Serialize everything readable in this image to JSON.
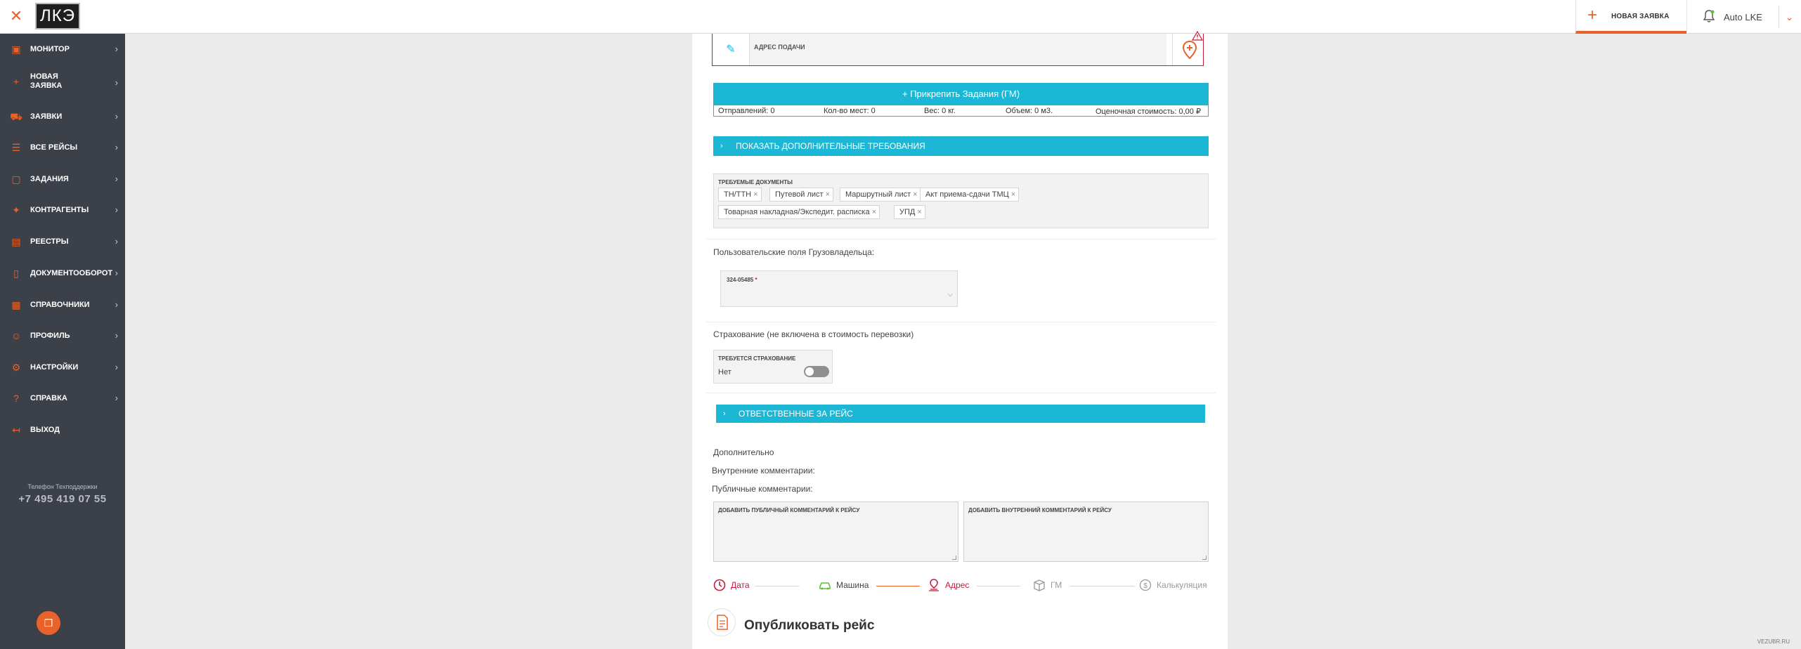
{
  "topbar": {
    "logo_text": "ЛКЭ",
    "new_order_label": "НОВАЯ ЗАЯВКА",
    "user_name": "Auto LKE"
  },
  "sidebar": {
    "items": [
      {
        "label": "МОНИТОР",
        "icon": "monitor-icon"
      },
      {
        "label": "НОВАЯ ЗАЯВКА",
        "icon": "plus-icon"
      },
      {
        "label": "ЗАЯВКИ",
        "icon": "truck-icon"
      },
      {
        "label": "ВСЕ РЕЙСЫ",
        "icon": "list-icon"
      },
      {
        "label": "ЗАДАНИЯ",
        "icon": "box-icon"
      },
      {
        "label": "КОНТРАГЕНТЫ",
        "icon": "handshake-icon"
      },
      {
        "label": "РЕЕСТРЫ",
        "icon": "registry-icon"
      },
      {
        "label": "ДОКУМЕНТООБОРОТ",
        "icon": "document-icon"
      },
      {
        "label": "СПРАВОЧНИКИ",
        "icon": "book-icon"
      },
      {
        "label": "ПРОФИЛЬ",
        "icon": "profile-icon"
      },
      {
        "label": "НАСТРОЙКИ",
        "icon": "gear-icon"
      },
      {
        "label": "СПРАВКА",
        "icon": "help-icon"
      },
      {
        "label": "ВЫХОД",
        "icon": "logout-icon"
      }
    ],
    "support_label": "Телефон Техподдержки",
    "support_phone": "+7 495 419 07 55"
  },
  "form": {
    "address_label": "АДРЕС ПОДАЧИ",
    "attach_button": "Прикрепить Задания (ГМ)",
    "stats": {
      "shipments": "Отправлений: 0",
      "places": "Кол-во мест: 0",
      "weight": "Вес: 0 кг.",
      "volume": "Объем: 0 м3.",
      "cost": "Оценочная стоимость: 0,00 ₽"
    },
    "extra_requirements": "ПОКАЗАТЬ ДОПОЛНИТЕЛЬНЫЕ ТРЕБОВАНИЯ",
    "docs_label": "ТРЕБУЕМЫЕ ДОКУМЕНТЫ",
    "docs": [
      "ТН/ТТН",
      "Путевой лист",
      "Маршрутный лист",
      "Акт приема-сдачи ТМЦ",
      "Товарная накладная/Экспедит. расписка",
      "УПД"
    ],
    "custom_fields_title": "Пользовательские поля Грузовладельца:",
    "custom_field_label": "324-05485",
    "custom_field_required": "*",
    "insurance_title": "Страхование (не включена в стоимость перевозки)",
    "insurance_label": "ТРЕБУЕТСЯ СТРАХОВАНИЕ",
    "insurance_value": "Нет",
    "responsible": "ОТВЕТСТВЕННЫЕ ЗА РЕЙС",
    "additional": "Дополнительно",
    "internal_comments": "Внутренние комментарии:",
    "public_comments": "Публичные комментарии:",
    "public_placeholder": "ДОБАВИТЬ ПУБЛИЧНЫЙ КОММЕНТАРИЙ К РЕЙСУ",
    "internal_placeholder": "ДОБАВИТЬ ВНУТРЕННИЙ КОММЕНТАРИЙ К РЕЙСУ"
  },
  "steps": [
    {
      "label": "Дата",
      "icon": "clock-icon",
      "color": "#c7193b"
    },
    {
      "label": "Машина",
      "icon": "car-icon",
      "color": "#444444"
    },
    {
      "label": "Адрес",
      "icon": "location-icon",
      "color": "#c7193b"
    },
    {
      "label": "ГМ",
      "icon": "box-icon",
      "color": "#999999"
    },
    {
      "label": "Калькуляция",
      "icon": "dollar-icon",
      "color": "#999999"
    }
  ],
  "publish_title": "Опубликовать рейс",
  "footer_brand": "VEZUBR.RU",
  "colors": {
    "accent": "#e8622a",
    "primary": "#1cb7d5",
    "error": "#c7193b",
    "sidebar": "#3c4049"
  }
}
